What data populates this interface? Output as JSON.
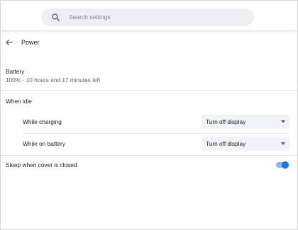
{
  "search": {
    "placeholder": "Search settings",
    "icon": "search-icon"
  },
  "subpage": {
    "title": "Power",
    "back_icon": "arrow-back-icon"
  },
  "battery": {
    "label": "Battery",
    "status": "100% - 10 hours and 17 minutes left"
  },
  "idle": {
    "section_label": "When idle",
    "rows": [
      {
        "label": "While charging",
        "selected": "Turn off display"
      },
      {
        "label": "While on battery",
        "selected": "Turn off display"
      }
    ]
  },
  "sleep_cover": {
    "label": "Sleep when cover is closed",
    "enabled": true
  },
  "colors": {
    "accent": "#1a73e8",
    "accent_track": "#8ab4f8",
    "select_bg": "#f1f3f4",
    "search_bg": "#eeeff1"
  }
}
